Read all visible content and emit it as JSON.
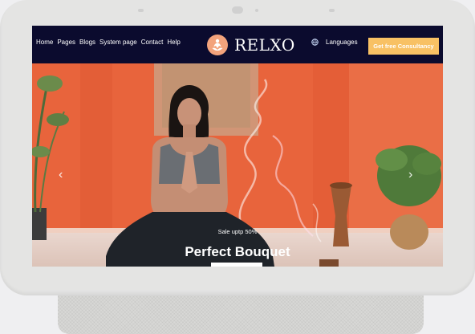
{
  "nav": {
    "links": [
      "Home",
      "Pages",
      "Blogs",
      "System page",
      "Contact",
      "Help"
    ],
    "brand": "RELXO",
    "languages_label": "Languages",
    "cta_label": "Get free Consultancy"
  },
  "hero": {
    "subtitle": "Sale uptp 50%",
    "title": "Perfect Bouquet"
  },
  "colors": {
    "nav_bg": "#0b0b2e",
    "cta_bg": "#f8c164",
    "logo_accent": "#f3a37c",
    "hero_wall": "#e8643c"
  },
  "icons": [
    "globe-icon",
    "lotus-logo-icon",
    "chevron-left-icon",
    "chevron-right-icon"
  ]
}
